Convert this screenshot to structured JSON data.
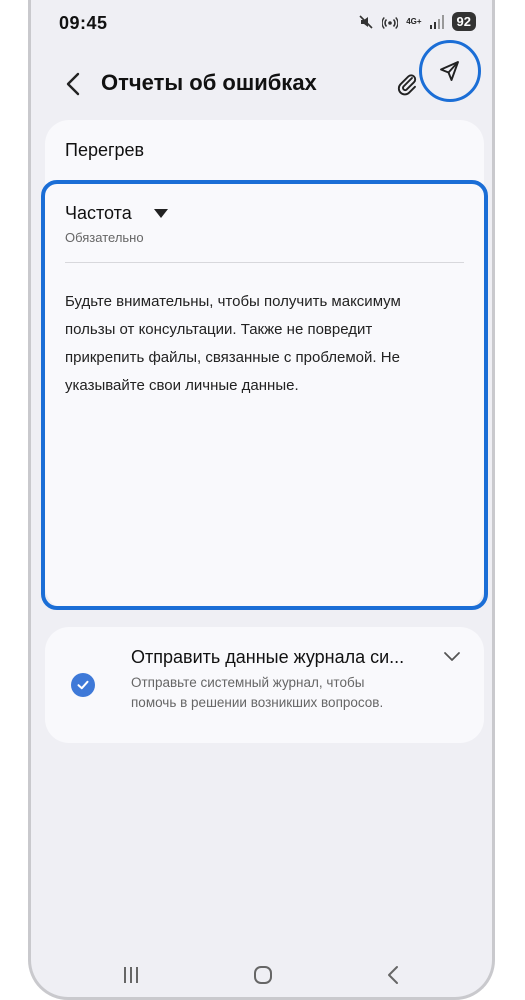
{
  "status_bar": {
    "time": "09:45",
    "network_label": "4G+",
    "battery": "92",
    "icons": [
      "mute-icon",
      "hotspot-icon",
      "signal-icon",
      "battery-icon"
    ]
  },
  "header": {
    "title": "Отчеты об ошибках",
    "icons": [
      "back-icon",
      "paperclip-icon",
      "send-icon"
    ],
    "highlight_color": "#1b6ed6"
  },
  "form": {
    "subject": "Перегрев",
    "frequency": {
      "label": "Частота",
      "required": "Обязательно"
    },
    "description": "Будьте внимательны, чтобы получить максимум пользы от консультации. Также не повредит прикрепить файлы, связанные с проблемой. Не указывайте свои личные данные."
  },
  "log": {
    "title": "Отправить данные журнала си...",
    "description": "Отправьте системный журнал, чтобы помочь в решении возникших вопросов.",
    "checked": true,
    "checkbox_color": "#3e79d8"
  },
  "navigation": {
    "icons": [
      "recents-icon",
      "home-icon",
      "back-nav-icon"
    ]
  }
}
